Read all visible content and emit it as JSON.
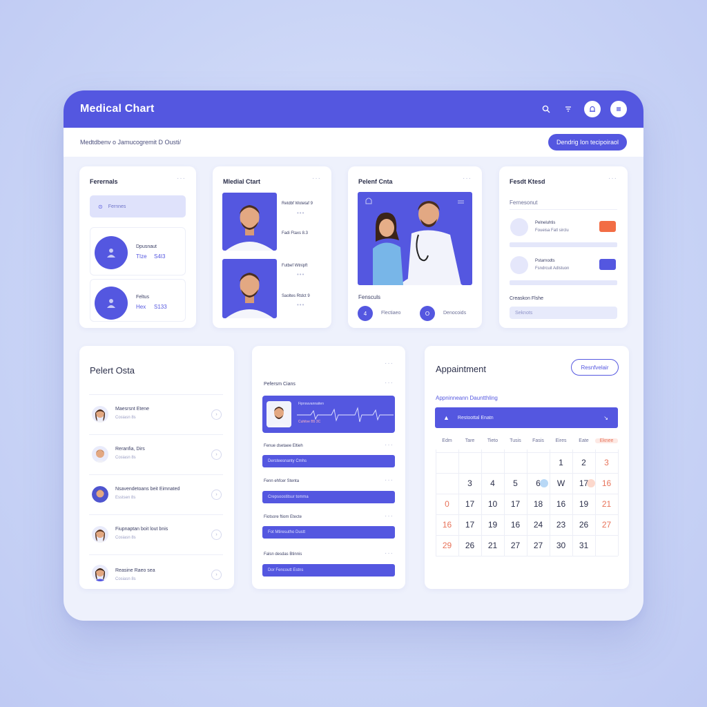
{
  "app": {
    "title": "Medical Chart"
  },
  "subbar": {
    "breadcrumb": "Medtdbenv o Jamucogremit D Ousti/",
    "action_label": "Dendrig Ion tecipoiraol"
  },
  "colors": {
    "primary": "#5457e0",
    "accent_orange": "#f26d45",
    "background": "#eef1fc"
  },
  "icons": {
    "search": "search-icon",
    "filter": "filter-icon",
    "notification": "bell-icon",
    "menu": "menu-icon"
  },
  "card_referrals": {
    "title": "Ferernals",
    "search_label": "Fernnes",
    "items": [
      {
        "name": "Dpusnaut",
        "meta": "TIze",
        "value": "S4I3"
      },
      {
        "name": "Feltus",
        "meta": "Hex",
        "value": "S133"
      }
    ]
  },
  "card_medical": {
    "title": "Mledial Ctart",
    "items": [
      {
        "label": "Retdbf Wotetaf 9"
      },
      {
        "label": "Fadi Ftaxs  8.3"
      },
      {
        "label": "Futbef Wtnipft"
      },
      {
        "label": "Saoltes Rtdct  9"
      }
    ]
  },
  "card_patient": {
    "title": "Pelenf Cnta",
    "caption": "Fensculs",
    "stat1_num": "4",
    "stat1_label": "Flectiaeo",
    "stat2_num": "O",
    "stat2_label": "Denocoids"
  },
  "card_result": {
    "title": "Fesdt Ktesd",
    "subtitle": "Fernesonut",
    "item1_name": "Pelneluhtis",
    "item1_sub": "Foueisa Fatl sirclu",
    "item2_name": "Pstarnodts",
    "item2_sub": "Fsndrcuit Adlstuon",
    "footer_title": "Creaskon Flshe",
    "footer_field": "Seknots"
  },
  "card_patient_data": {
    "title": "Pelert Osta",
    "rows": [
      {
        "name": "Maesrsnt Etene",
        "sub": "Cosiasn 8s"
      },
      {
        "name": "Reranfia, Dirs",
        "sub": "Cosiasn 8s"
      },
      {
        "name": "Nsavendetoans beit Eimnated",
        "sub": "Esstsen 8s"
      },
      {
        "name": "Fiupnaptan boit lout bnis",
        "sub": "Cosiasn 8s"
      },
      {
        "name": "Reasine Raeo sea",
        "sub": "Cosiasn 8s"
      }
    ]
  },
  "card_reports": {
    "title": "Pefersm Cians",
    "ecg_title": "Fipnouvannaiten",
    "ecg_legend": "Cuhitve  B5  3C",
    "sections": [
      {
        "title": "Fenue dsetaee Eltieh",
        "bar": "Dersteesnanty Cmhs"
      },
      {
        "title": "Fenn ehfcer Stenta",
        "bar": "Crepsoostitsur tomma"
      },
      {
        "title": "Fiotsore ftiom Etecte",
        "bar": "Fot Mtiresutho Dustt"
      },
      {
        "title": "Falsn desdas Btinnis",
        "bar": "Dor Fencoutt Estns"
      }
    ]
  },
  "card_appointment": {
    "title": "Appaintment",
    "button_label": "Resnfvelair",
    "subtitle": "Appninneann Dauntthling",
    "banner": "Restoottal Enatn",
    "weekdays": [
      "Edm",
      "Tare",
      "Tieto",
      "Tusis",
      "Fasis",
      "Eires",
      "Eate",
      "Eknee"
    ],
    "rows": [
      [
        "",
        "",
        "",
        "",
        "",
        "1",
        "2",
        "3"
      ],
      [
        "",
        "3",
        "4",
        "5",
        "6",
        "W",
        "17",
        "16"
      ],
      [
        "0",
        "17",
        "10",
        "17",
        "18",
        "16",
        "19",
        "21"
      ],
      [
        "16",
        "17",
        "19",
        "16",
        "24",
        "23",
        "26",
        "27"
      ],
      [
        "29",
        "26",
        "21",
        "27",
        "27",
        "30",
        "31",
        ""
      ]
    ]
  }
}
